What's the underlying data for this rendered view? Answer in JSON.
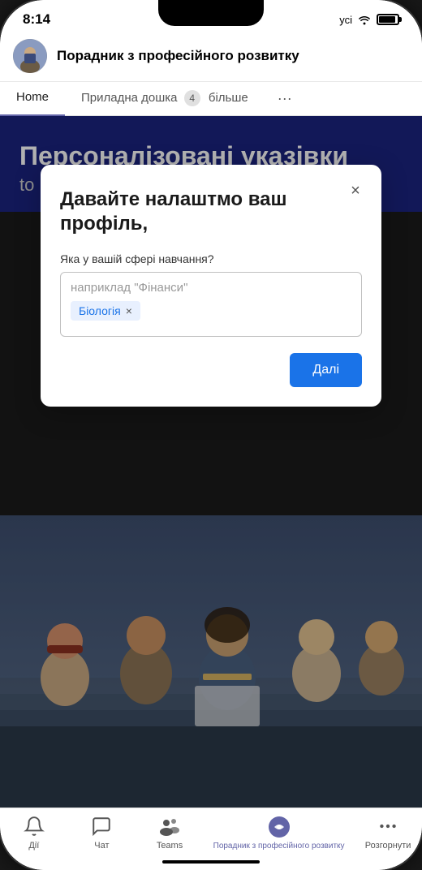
{
  "status": {
    "time": "8:14",
    "carrier": "усі",
    "wifi": true,
    "battery": 90
  },
  "header": {
    "title": "Порадник з професійного розвитку"
  },
  "tabs": {
    "items": [
      {
        "label": "Home",
        "active": true
      },
      {
        "label": "Приладна дошка",
        "active": false,
        "badge": "4"
      },
      {
        "label": "більше",
        "active": false
      }
    ],
    "more_icon": "···"
  },
  "hero": {
    "title": "Персоналізовані указівки",
    "subtitle": "to navigate your"
  },
  "modal": {
    "title": "Давайте налаштмо ваш профіль,",
    "field_label": "Яка у вашій сфері навчання?",
    "input_placeholder": "наприклад \"Фінанси\"",
    "tag": "Біологія",
    "close_label": "×",
    "next_button": "Далі"
  },
  "bottom_nav": {
    "items": [
      {
        "label": "Дії",
        "icon": "bell",
        "active": false
      },
      {
        "label": "Чат",
        "icon": "chat",
        "active": false
      },
      {
        "label": "Teams",
        "icon": "teams",
        "active": false
      },
      {
        "label": "Порадник з професійного розвитку",
        "icon": "app",
        "active": true
      },
      {
        "label": "Розгорнути",
        "icon": "more",
        "active": false
      }
    ]
  }
}
